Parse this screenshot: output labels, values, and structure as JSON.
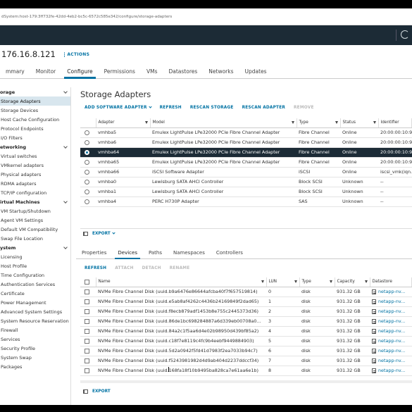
{
  "url": "dSystem:host-179:3ff732fe-42dd-4eb2-bc5c-6572c585e342/configure/storage-adapters",
  "host": {
    "ip": "176.16.8.121",
    "actions_label": "ACTIONS"
  },
  "tabs": [
    "mmary",
    "Monitor",
    "Configure",
    "Permissions",
    "VMs",
    "Datastores",
    "Networks",
    "Updates"
  ],
  "active_tab": "Configure",
  "sidebar": [
    {
      "type": "group",
      "label": "orage"
    },
    {
      "type": "item",
      "label": "Storage Adapters",
      "active": true
    },
    {
      "type": "item",
      "label": "Storage Devices"
    },
    {
      "type": "item",
      "label": "Host Cache Configuration"
    },
    {
      "type": "item",
      "label": "Protocol Endpoints"
    },
    {
      "type": "item",
      "label": "I/O Filters"
    },
    {
      "type": "group",
      "label": "etworking"
    },
    {
      "type": "item",
      "label": "Virtual switches"
    },
    {
      "type": "item",
      "label": "VMkernel adapters"
    },
    {
      "type": "item",
      "label": "Physical adapters"
    },
    {
      "type": "item",
      "label": "RDMA adapters"
    },
    {
      "type": "item",
      "label": "TCP/IP configuration"
    },
    {
      "type": "group",
      "label": "irtual Machines"
    },
    {
      "type": "item",
      "label": "VM Startup/Shutdown"
    },
    {
      "type": "item",
      "label": "Agent VM Settings"
    },
    {
      "type": "item",
      "label": "Default VM Compatibility"
    },
    {
      "type": "item",
      "label": "Swap File Location"
    },
    {
      "type": "group",
      "label": "ystem"
    },
    {
      "type": "item",
      "label": "Licensing"
    },
    {
      "type": "item",
      "label": "Host Profile"
    },
    {
      "type": "item",
      "label": "Time Configuration"
    },
    {
      "type": "item",
      "label": "Authentication Services"
    },
    {
      "type": "item",
      "label": "Certificate"
    },
    {
      "type": "item",
      "label": "Power Management"
    },
    {
      "type": "item",
      "label": "Advanced System Settings"
    },
    {
      "type": "item",
      "label": "System Resource Reservation"
    },
    {
      "type": "item",
      "label": "Firewall"
    },
    {
      "type": "item",
      "label": "Services"
    },
    {
      "type": "item",
      "label": "Security Profile"
    },
    {
      "type": "item",
      "label": "System Swap"
    },
    {
      "type": "item",
      "label": "Packages"
    }
  ],
  "page_title": "Storage Adapters",
  "toolbar": {
    "add": "ADD SOFTWARE ADAPTER",
    "refresh": "REFRESH",
    "rescan_storage": "RESCAN STORAGE",
    "rescan_adapter": "RESCAN ADAPTER",
    "remove": "REMOVE"
  },
  "adapters": {
    "columns": [
      "Adapter",
      "Model",
      "Type",
      "Status",
      "Identifier"
    ],
    "rows": [
      {
        "adapter": "vmhba5",
        "model": "Emulex LightPulse LPe32000 PCIe Fibre Channel Adapter",
        "type": "Fibre Channel",
        "status": "Online",
        "identifier": "20:00:00:10:9",
        "selected": false
      },
      {
        "adapter": "vmhba6",
        "model": "Emulex LightPulse LPe32000 PCIe Fibre Channel Adapter",
        "type": "Fibre Channel",
        "status": "Online",
        "identifier": "20:00:00:10:9",
        "selected": false
      },
      {
        "adapter": "vmhba64",
        "model": "Emulex LightPulse LPe32000 PCIe Fibre Channel Adapter",
        "type": "Fibre Channel",
        "status": "Online",
        "identifier": "20:00:00:10:9",
        "selected": true
      },
      {
        "adapter": "vmhba65",
        "model": "Emulex LightPulse LPe32000 PCIe Fibre Channel Adapter",
        "type": "Fibre Channel",
        "status": "Online",
        "identifier": "20:00:00:10:9",
        "selected": false
      },
      {
        "adapter": "vmhba66",
        "model": "iSCSI Software Adapter",
        "type": "iSCSI",
        "status": "Online",
        "identifier": "iscsi_vmk(iqn.1",
        "selected": false
      },
      {
        "adapter": "vmhba0",
        "model": "Lewisburg SATA AHCI Controller",
        "type": "Block SCSI",
        "status": "Unknown",
        "identifier": "--",
        "selected": false
      },
      {
        "adapter": "vmhba1",
        "model": "Lewisburg SATA AHCI Controller",
        "type": "Block SCSI",
        "status": "Unknown",
        "identifier": "--",
        "selected": false
      },
      {
        "adapter": "vmhba4",
        "model": "PERC H730P Adapter",
        "type": "SAS",
        "status": "Unknown",
        "identifier": "--",
        "selected": false
      }
    ],
    "export_label": "EXPORT"
  },
  "subtabs": [
    "Properties",
    "Devices",
    "Paths",
    "Namespaces",
    "Controllers"
  ],
  "active_subtab": "Devices",
  "devices_toolbar": {
    "refresh": "REFRESH",
    "attach": "ATTACH",
    "detach": "DETACH",
    "rename": "RENAME"
  },
  "devices": {
    "columns": [
      "Name",
      "LUN",
      "Type",
      "Capacity",
      "Datastore"
    ],
    "rows": [
      {
        "name": "NVMe Fibre Channel Disk (uuid.b9a6476e86644afcba40f7f657519814)",
        "lun": "0",
        "type": "disk",
        "capacity": "931.32 GB",
        "datastore": "netapp-nv..."
      },
      {
        "name": "NVMe Fibre Channel Disk (uuid.e5ab8af4262c4436b24169849f2dad65)",
        "lun": "1",
        "type": "disk",
        "capacity": "931.32 GB",
        "datastore": "netapp-nv..."
      },
      {
        "name": "NVMe Fibre Channel Disk (uuid.f8ecb879adf1453b8e755c2445373d36)",
        "lun": "2",
        "type": "disk",
        "capacity": "931.32 GB",
        "datastore": "netapp-nv..."
      },
      {
        "name": "NVMe Fibre Channel Disk (uuid.86de1bc698284887a6d339eb00708a0...",
        "lun": "3",
        "type": "disk",
        "capacity": "931.32 GB",
        "datastore": "netapp-nv..."
      },
      {
        "name": "NVMe Fibre Channel Disk (uuid.84a2c1f5aa6d4e02b98950d439bf85a2)",
        "lun": "4",
        "type": "disk",
        "capacity": "931.32 GB",
        "datastore": "netapp-nv..."
      },
      {
        "name": "NVMe Fibre Channel Disk (uuid.c18f7e8119c4fc9b4eebf9449884903)",
        "lun": "5",
        "type": "disk",
        "capacity": "931.32 GB",
        "datastore": "netapp-nv..."
      },
      {
        "name": "NVMe Fibre Channel Disk (uuid.5d2a0942f5fd41d7983f2ea7033b94c7)",
        "lun": "6",
        "type": "disk",
        "capacity": "931.32 GB",
        "datastore": "netapp-nv..."
      },
      {
        "name": "NVMe Fibre Channel Disk (uuid.f5243981982d4d9ab404d2237ddccf34)",
        "lun": "7",
        "type": "disk",
        "capacity": "931.32 GB",
        "datastore": "netapp-nv..."
      },
      {
        "name": "NVMe Fibre Channel Disk (uuid.168fa18f10b9495ba828ca7e61aa6e1b)",
        "lun": "8",
        "type": "disk",
        "capacity": "931.32 GB",
        "datastore": "netapp-nv..."
      }
    ],
    "export_label": "EXPORT"
  },
  "colors": {
    "nav": "#1c2b36",
    "accent": "#0072a3",
    "selected_sidebar": "#d8e6ee"
  },
  "icons": [
    "refresh-icon",
    "actions-menu-icon",
    "filter-icon",
    "chevron-down-icon",
    "radio-icon",
    "checkbox-icon",
    "datastore-icon",
    "column-toggle-icon"
  ]
}
